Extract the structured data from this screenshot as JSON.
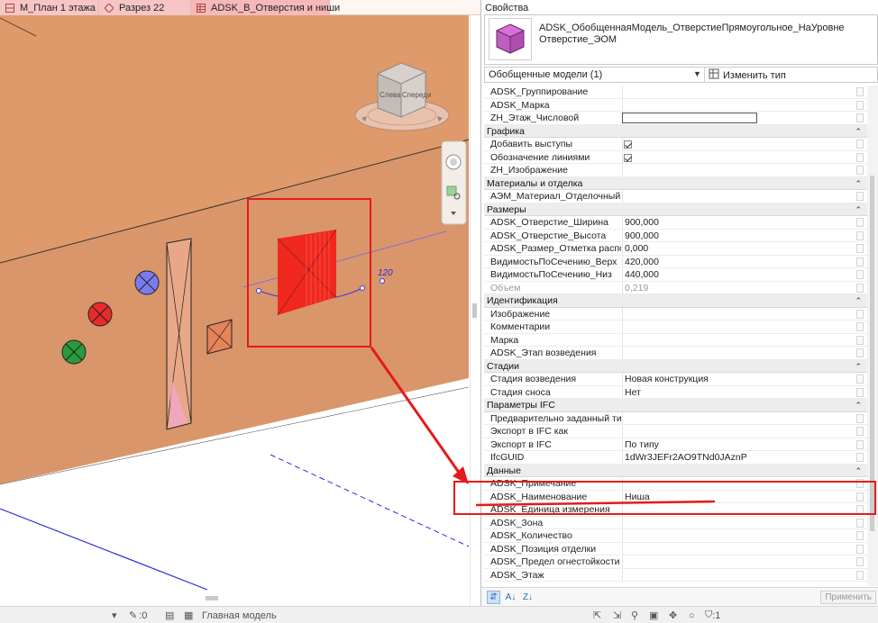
{
  "tabs": [
    {
      "label": "М_План 1 этажа"
    },
    {
      "label": "Разрез 22"
    },
    {
      "label": "ADSK_В_Отверстия и ниши"
    }
  ],
  "viewport": {
    "dimension_label": "120",
    "viewcube_left": "Слева",
    "viewcube_front": "Спереди",
    "colors": {
      "wall": "#de9a6a",
      "wall_dark": "#c6875c",
      "highlight": "#f0281e",
      "annotation": "#e51a1a",
      "section_line": "#2a2ae0"
    }
  },
  "status": {
    "worksets_count": ":0",
    "model_label": "Главная модель",
    "filter_count": ":1"
  },
  "properties": {
    "title": "Свойства",
    "type_name": "ADSK_ОбобщеннаяМодель_ОтверстиеПрямоугольное_НаУровне",
    "type_sub": "Отверстие_ЭОМ",
    "category": "Обобщенные модели (1)",
    "edit_type": "Изменить тип",
    "apply": "Применить",
    "rows": [
      {
        "name": "ADSK_Группирование",
        "value": ""
      },
      {
        "name": "ADSK_Марка",
        "value": ""
      },
      {
        "name": "ZH_Этаж_Числовой",
        "value": ""
      },
      {
        "section": "Графика"
      },
      {
        "name": "Добавить выступы",
        "value": ""
      },
      {
        "name": "Обозначение линиями",
        "value": ""
      },
      {
        "name": "ZH_Изображение",
        "value": ""
      },
      {
        "section": "Материалы и отделка"
      },
      {
        "name": "АЭМ_Материал_Отделочный",
        "value": ""
      },
      {
        "section": "Размеры"
      },
      {
        "name": "ADSK_Отверстие_Ширина",
        "value": "900,000"
      },
      {
        "name": "ADSK_Отверстие_Высота",
        "value": "900,000"
      },
      {
        "name": "ADSK_Размер_Отметка распол...",
        "value": "0,000"
      },
      {
        "name": "ВидимостьПоСечению_Верх",
        "value": "420,000"
      },
      {
        "name": "ВидимостьПоСечению_Низ",
        "value": "440,000"
      },
      {
        "name": "Объем",
        "value": "0,219"
      },
      {
        "section": "Идентификация"
      },
      {
        "name": "Изображение",
        "value": ""
      },
      {
        "name": "Комментарии",
        "value": ""
      },
      {
        "name": "Марка",
        "value": ""
      },
      {
        "name": "ADSK_Этап возведения",
        "value": ""
      },
      {
        "section": "Стадии"
      },
      {
        "name": "Стадия возведения",
        "value": "Новая конструкция"
      },
      {
        "name": "Стадия сноса",
        "value": "Нет"
      },
      {
        "section": "Параметры IFC"
      },
      {
        "name": "Предварительно заданный тип...",
        "value": ""
      },
      {
        "name": "Экспорт в IFC как",
        "value": ""
      },
      {
        "name": "Экспорт в IFC",
        "value": "По типу"
      },
      {
        "name": "IfcGUID",
        "value": "1dWr3JEFr2AO9TNd0JAznP"
      },
      {
        "section": "Данные"
      },
      {
        "name": "ADSK_Примечание",
        "value": ""
      },
      {
        "name": "ADSK_Наименование",
        "value": "Ниша"
      },
      {
        "name": "ADSK_Единица измерения",
        "value": ""
      },
      {
        "name": "ADSK_Зона",
        "value": ""
      },
      {
        "name": "ADSK_Количество",
        "value": ""
      },
      {
        "name": "ADSK_Позиция отделки",
        "value": ""
      },
      {
        "name": "ADSK_Предел огнестойкости э...",
        "value": ""
      },
      {
        "name": "ADSK_Этаж",
        "value": ""
      }
    ]
  }
}
